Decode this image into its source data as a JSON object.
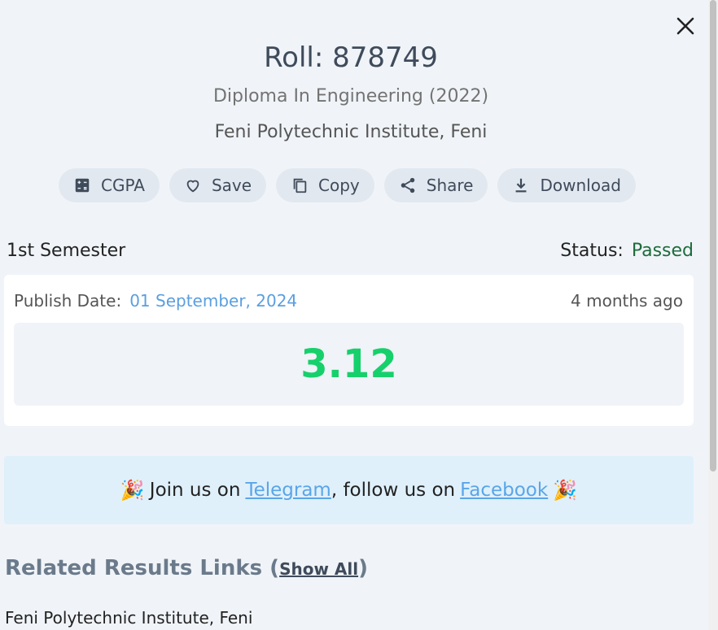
{
  "header": {
    "roll": "Roll: 878749",
    "program": "Diploma In Engineering (2022)",
    "institute": "Feni Polytechnic Institute, Feni"
  },
  "actions": [
    {
      "label": "CGPA",
      "icon": "calculator-icon"
    },
    {
      "label": "Save",
      "icon": "heart-icon"
    },
    {
      "label": "Copy",
      "icon": "copy-icon"
    },
    {
      "label": "Share",
      "icon": "share-icon"
    },
    {
      "label": "Download",
      "icon": "download-icon"
    }
  ],
  "semester": {
    "name": "1st Semester",
    "status_label": "Status:",
    "status_value": "Passed",
    "publish_label": "Publish Date:",
    "publish_date": "01 September, 2024",
    "ago": "4 months ago",
    "gpa": "3.12"
  },
  "banner": {
    "prefix": "Join us on",
    "telegram": "Telegram",
    "middle": ", follow us on",
    "facebook": "Facebook"
  },
  "related": {
    "title": "Related Results Links",
    "show_all": "Show All",
    "items": [
      "Feni Polytechnic Institute, Feni"
    ]
  },
  "colors": {
    "gpa": "#16d06c",
    "passed": "#1e6b3c",
    "link": "#5aa5e8"
  }
}
